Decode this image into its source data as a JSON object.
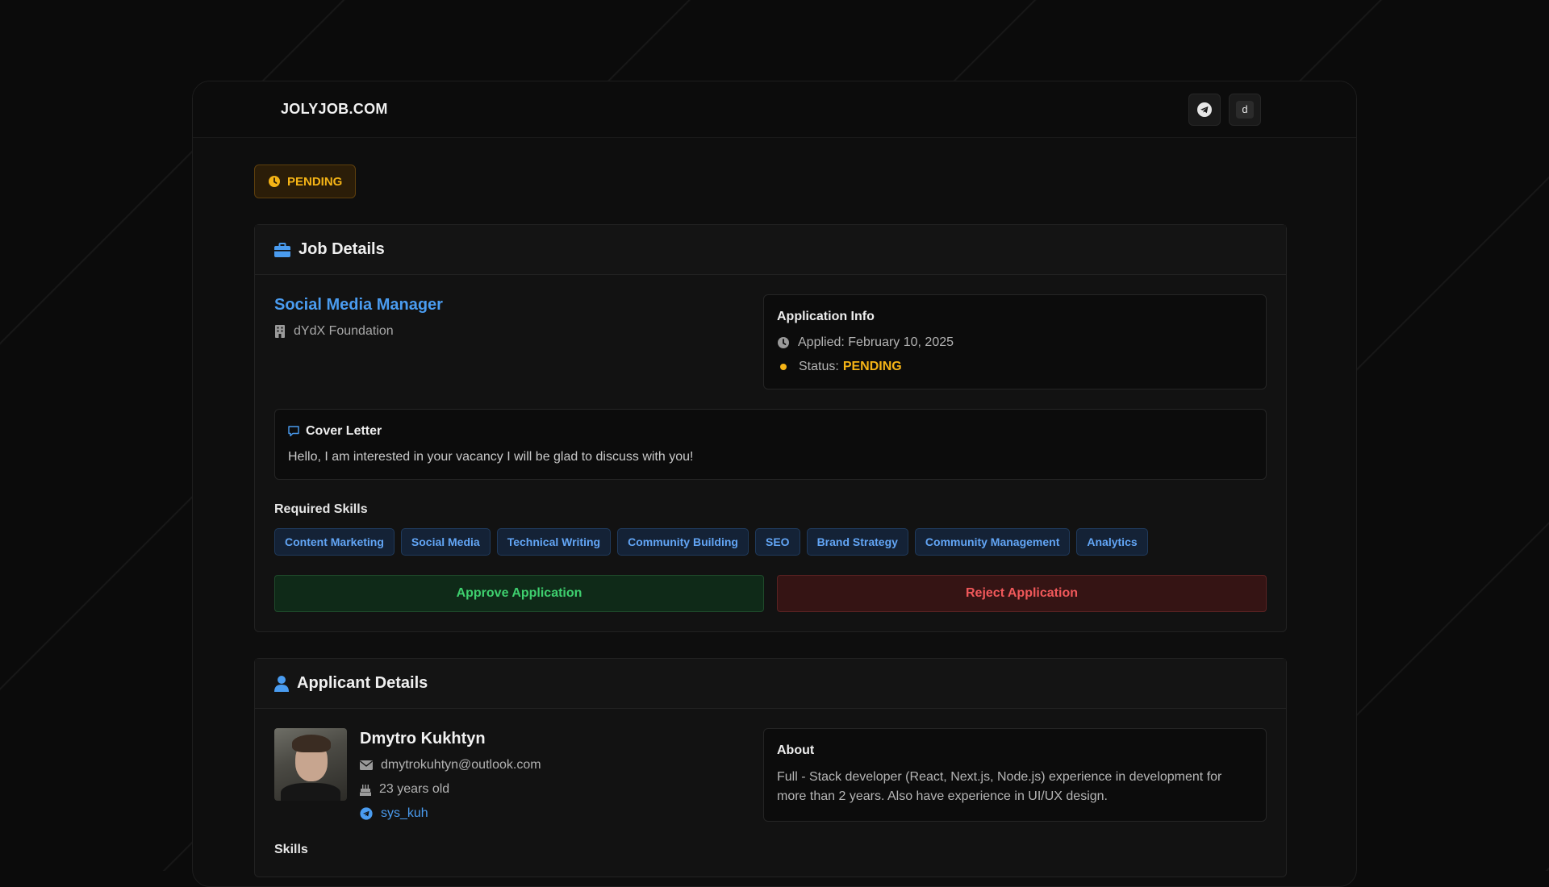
{
  "brand": {
    "logo": "JOLYJOB.COM",
    "user_initial": "d"
  },
  "status_badge": {
    "label": "PENDING",
    "color": "#f5b416"
  },
  "job_details": {
    "heading": "Job Details",
    "title": "Social Media Manager",
    "company": "dYdX Foundation",
    "application_info": {
      "heading": "Application Info",
      "applied": "Applied: February 10, 2025",
      "status_prefix": "Status:",
      "status_value": "PENDING"
    },
    "cover_letter": {
      "heading": "Cover Letter",
      "text": "Hello, I am interested in your vacancy I will be glad to discuss with you!"
    },
    "required_skills_label": "Required Skills",
    "required_skills": [
      "Content Marketing",
      "Social Media",
      "Technical Writing",
      "Community Building",
      "SEO",
      "Brand Strategy",
      "Community Management",
      "Analytics"
    ],
    "approve_label": "Approve Application",
    "reject_label": "Reject Application"
  },
  "applicant_details": {
    "heading": "Applicant Details",
    "name": "Dmytro Kukhtyn",
    "email": "dmytrokuhtyn@outlook.com",
    "age": "23 years old",
    "telegram": "sys_kuh",
    "about": {
      "heading": "About",
      "text": "Full - Stack developer (React, Next.js, Node.js) experience in development for more than 2 years. Also have experience in UI/UX design."
    },
    "skills_label": "Skills"
  },
  "colors": {
    "accent": "#4a9cf0",
    "pending": "#f5b416",
    "approve": "#3ecf6e",
    "reject": "#f0585a"
  }
}
